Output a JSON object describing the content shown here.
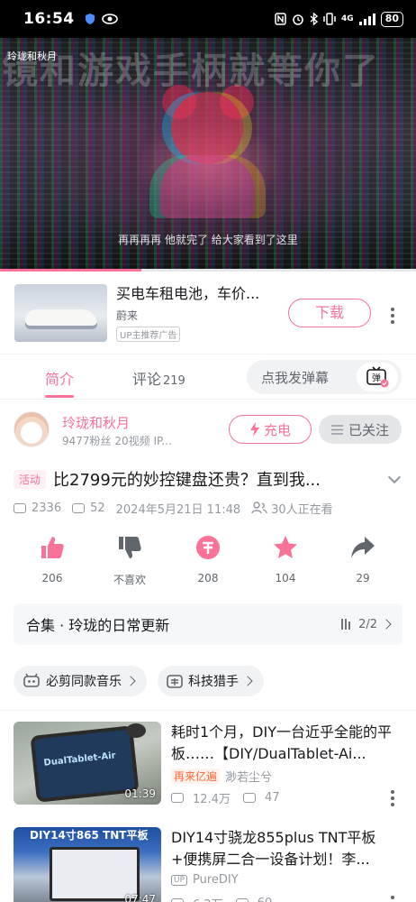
{
  "status_bar": {
    "time": "16:54",
    "network": "4G",
    "battery": "80"
  },
  "video": {
    "overlay_text": "镜和游戏手柄就等你了",
    "uploader_watermark": "玲珑和秋月",
    "subtitle": "再再再再 他就完了 给大家看到了这里",
    "progress_fraction": 0.34
  },
  "ad": {
    "title": "买电车租电池，车价...",
    "brand": "蔚来",
    "tag": "UP主推荐广告",
    "download_label": "下载"
  },
  "tabs": {
    "intro_label": "简介",
    "comments_label": "评论",
    "comments_count": "219",
    "danmaku_placeholder": "点我发弹幕",
    "danmaku_button": "弹"
  },
  "author": {
    "name": "玲珑和秋月",
    "meta": "9477粉丝   20视频   IP...",
    "charge_label": "充电",
    "follow_label": "已关注"
  },
  "video_info": {
    "event_tag": "活动",
    "title": "比2799元的妙控键盘还贵？直到我...",
    "views": "2336",
    "danmaku_count": "52",
    "date": "2024年5月21日 11:48",
    "watching": "30人正在看"
  },
  "actions": {
    "like": "206",
    "dislike": "不喜欢",
    "coin": "208",
    "favorite": "104",
    "share": "29"
  },
  "collection": {
    "title": "合集 · 玲珑的日常更新",
    "progress": "2/2"
  },
  "tags": [
    "必剪同款音乐",
    "科技猎手"
  ],
  "recommended": [
    {
      "title": "耗时1个月，DIY一台近乎全能的平板……【DIY/DualTablet-Ai...",
      "badge": "再来亿遍",
      "author": "渺若尘兮",
      "views": "12.4万",
      "danmaku": "47",
      "duration": "01:39",
      "thumb_text": "DualTablet-Air"
    },
    {
      "title": "DIY14寸骁龙855plus TNT平板+便携屏二合一设备计划！李...",
      "up_tag": "UP",
      "author": "PureDIY",
      "views": "6.2万",
      "danmaku": "60",
      "duration": "07:47",
      "thumb_text": "DIY14寸865 TNT平板"
    }
  ],
  "colors": {
    "accent": "#fb7299",
    "secondary_text": "#9499a0",
    "badge_orange": "#ff6a3d"
  }
}
